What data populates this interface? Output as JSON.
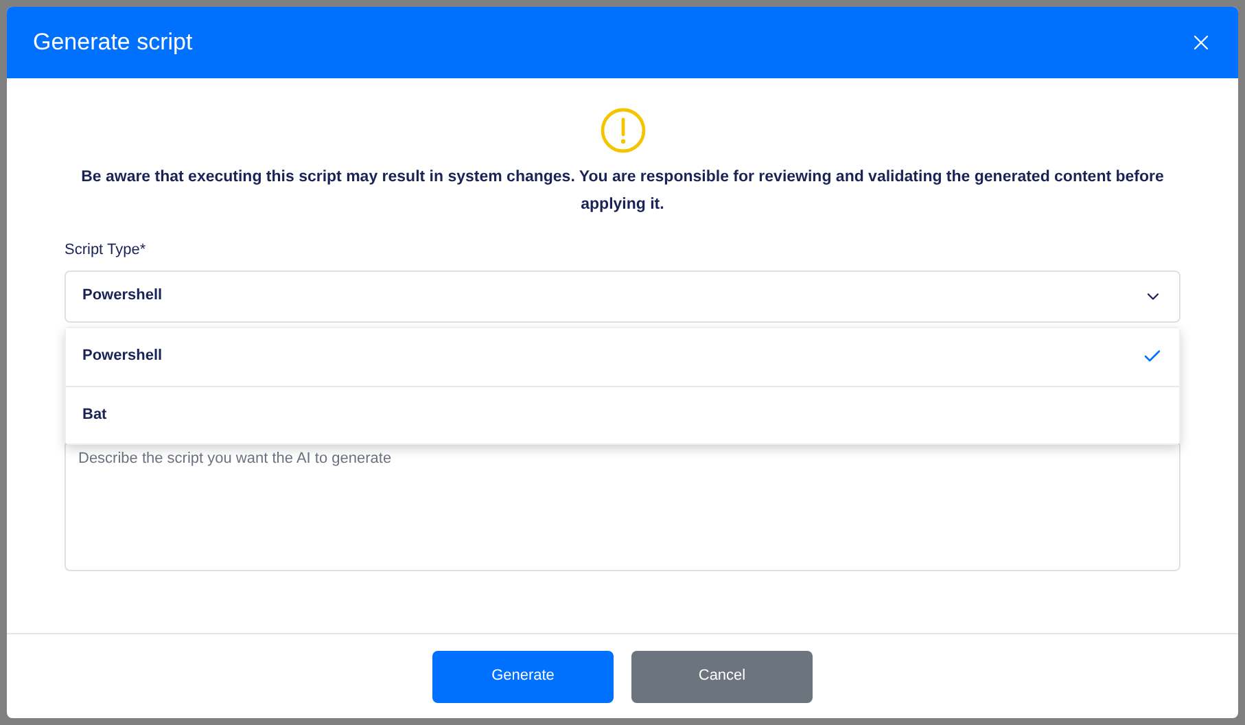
{
  "dialog": {
    "title": "Generate script"
  },
  "warning": "Be aware that executing this script may result in system changes. You are responsible for reviewing and validating the generated content before applying it.",
  "script_type": {
    "label": "Script Type*",
    "value": "Powershell",
    "expanded": true,
    "options": [
      {
        "label": "Powershell",
        "selected": true
      },
      {
        "label": "Bat",
        "selected": false
      }
    ]
  },
  "description": {
    "placeholder": "Describe the script you want the AI to generate"
  },
  "buttons": [
    {
      "label": "Generate",
      "kind": "primary"
    },
    {
      "label": "Cancel",
      "kind": "secondary"
    }
  ]
}
